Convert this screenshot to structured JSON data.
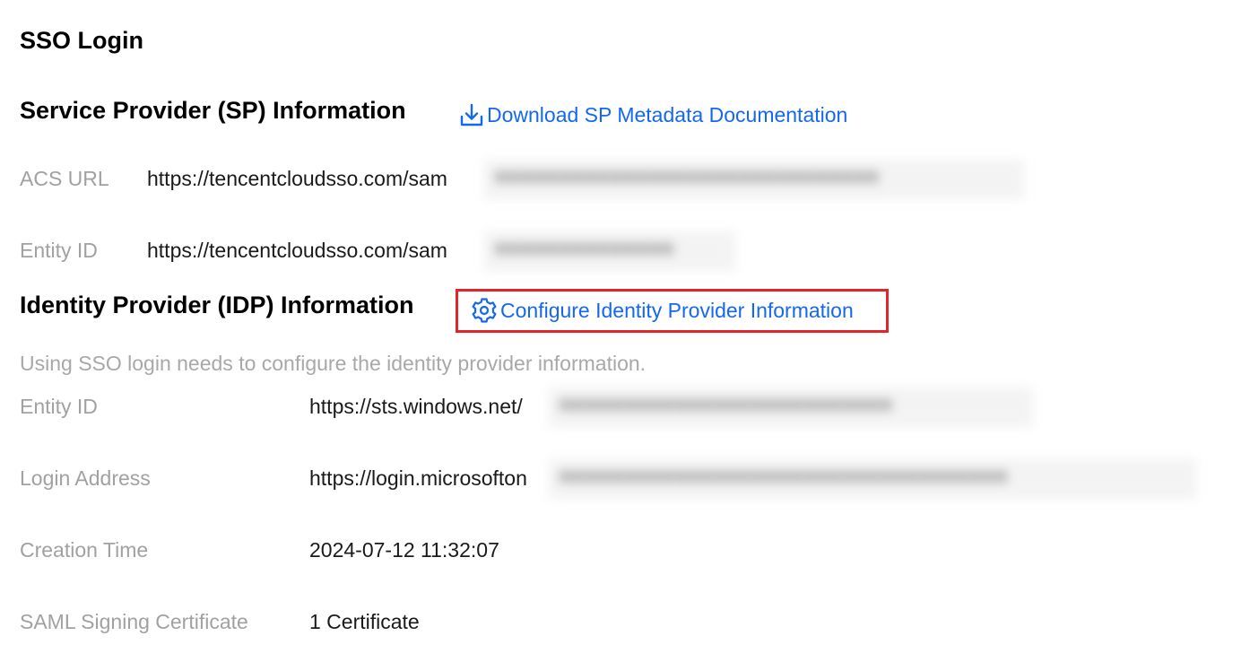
{
  "page": {
    "title": "SSO Login"
  },
  "sp": {
    "title": "Service Provider (SP) Information",
    "download_link": "Download SP Metadata Documentation",
    "download_icon": "download-icon",
    "fields": [
      {
        "label": "ACS URL",
        "value": "https://tencentcloudsso.com/sam"
      },
      {
        "label": "Entity ID",
        "value": "https://tencentcloudsso.com/sam"
      }
    ]
  },
  "idp": {
    "title": "Identity Provider (IDP) Information",
    "configure_link": "Configure Identity Provider Information",
    "configure_icon": "gear-icon",
    "hint": "Using SSO login needs to configure the identity provider information.",
    "fields": [
      {
        "label": "Entity ID",
        "value": "https://sts.windows.net/"
      },
      {
        "label": "Login Address",
        "value": "https://login.microsofton"
      },
      {
        "label": "Creation Time",
        "value": "2024-07-12 11:32:07"
      },
      {
        "label": "SAML Signing Certificate",
        "value": "1 Certificate"
      }
    ]
  },
  "colors": {
    "link": "#1468f0",
    "highlight": "#e3252a",
    "label": "#a1a1a1"
  }
}
